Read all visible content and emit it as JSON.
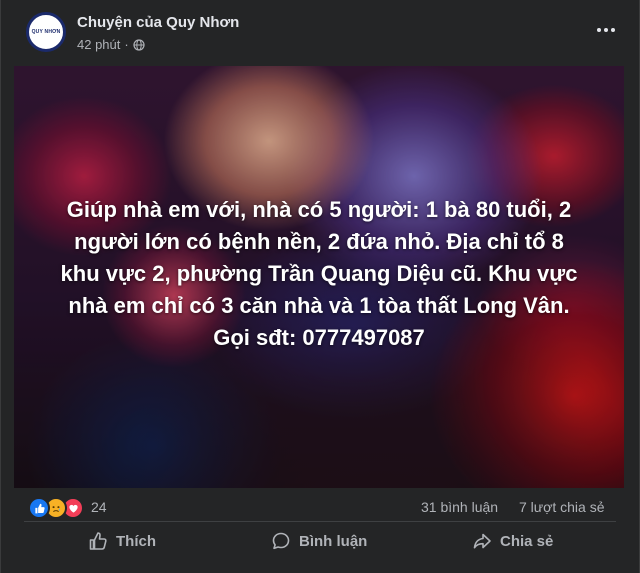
{
  "post": {
    "page_name": "Chuyện của Quy Nhơn",
    "time": "42 phút",
    "avatar_text": "QUY NHƠN",
    "image_text": "Giúp nhà em với, nhà có 5 người: 1 bà 80 tuổi, 2 người lớn có bệnh nền, 2 đứa nhỏ. Địa chỉ tổ 8 khu vực 2, phường Trần Quang Diệu cũ. Khu vực nhà em chỉ có 3 căn nhà và 1 tòa thất Long Vân. Gọi sđt: 0777497087",
    "image_lines": [
      "Giúp nhà em với, nhà có 5 người: 1 bà 80 tuổi, 2",
      "người lớn có bệnh nền, 2 đứa nhỏ. Địa chỉ tổ 8",
      "khu vực 2, phường Trần Quang Diệu cũ. Khu vực",
      "nhà em chỉ có 3 căn nhà và 1 tòa thất Long Vân.",
      "Gọi sđt: 0777497087"
    ]
  },
  "stats": {
    "reactions": [
      "like",
      "sad",
      "love"
    ],
    "reaction_count": "24",
    "comments": "31 bình luận",
    "shares": "7 lượt chia sẻ"
  },
  "actions": {
    "like": "Thích",
    "comment": "Bình luận",
    "share": "Chia sẻ"
  },
  "colors": {
    "background": "#242526",
    "text": "#e4e6eb",
    "muted": "#b0b3b8",
    "like": "#1877f2",
    "love": "#f33e58",
    "sad": "#f7b125"
  }
}
